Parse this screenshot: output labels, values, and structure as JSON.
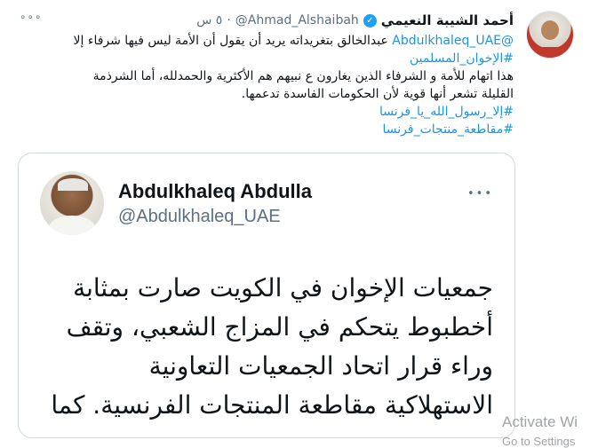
{
  "author": {
    "name": "أحمد الشيبة النعيمي",
    "handle": "@Ahmad_Alshaibah",
    "time": "٥ س",
    "separator": "·",
    "verified_icon": "verified-badge-icon",
    "more_icon": "more-options-icon"
  },
  "tweet": {
    "lines": [
      {
        "mention": "@Abdulkhaleq_UAE",
        "text": " عبدالخالق بتغريداته يريد أن يقول أن الأمة ليس فيها شرفاء إلا"
      },
      {
        "hashtag": "#الإخوان_المسلمين"
      },
      {
        "text": "هذا اتهام للأمة و الشرفاء الذين يغارون ع نبيهم هم الأكثرية والحمدلله، أما الشرذمة"
      },
      {
        "text": "القليلة تشعر أنها قوية لأن الحكومات الفاسدة تدعمها."
      },
      {
        "hashtag": "#إلا_رسول_الله_يا_فرنسا"
      },
      {
        "hashtag": "#مقاطعة_منتجات_فرنسا"
      }
    ]
  },
  "quoted": {
    "name": "Abdulkhaleq Abdulla",
    "handle": "@Abdulkhaleq_UAE",
    "more_icon": "more-options-icon",
    "lines": [
      "جمعيات الإخوان في الكويت صارت بمثابة",
      "أخطبوط يتحكم في المزاج الشعبي، وتقف",
      "وراء قرار اتحاد الجمعيات التعاونية",
      "الاستهلاكية مقاطعة المنتجات الفرنسية. كما"
    ]
  },
  "watermark": {
    "title": "Activate Wi",
    "subtitle": "Go to Settings"
  },
  "colors": {
    "link": "#1b95e0",
    "verified": "#1da1f2",
    "secondary_text": "#5b7083"
  }
}
